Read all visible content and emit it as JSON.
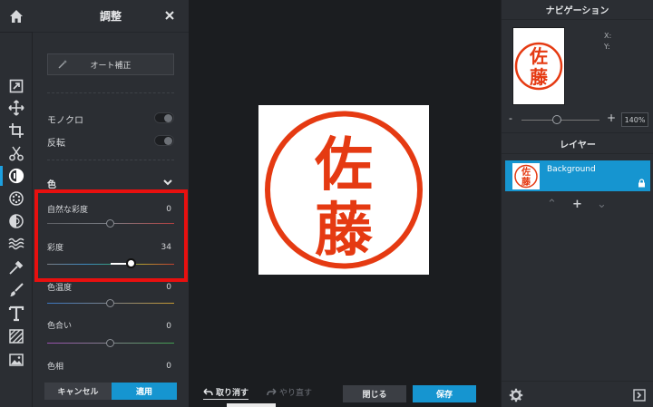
{
  "panel": {
    "title": "調整",
    "auto_fix_label": "オート補正",
    "toggles": [
      {
        "label": "モノクロ",
        "on": false
      },
      {
        "label": "反転",
        "on": false
      }
    ],
    "section_label": "色",
    "sliders": [
      {
        "label": "自然な彩度",
        "value": "0"
      },
      {
        "label": "彩度",
        "value": "34"
      },
      {
        "label": "色温度",
        "value": "0"
      },
      {
        "label": "色合い",
        "value": "0"
      },
      {
        "label": "色相",
        "value": "0"
      }
    ],
    "cancel_label": "キャンセル",
    "apply_label": "適用"
  },
  "canvas": {
    "seal_text": "佐藤",
    "undo_label": "取り消す",
    "redo_label": "やり直す",
    "close_label": "閉じる",
    "save_label": "保存"
  },
  "navigator": {
    "title": "ナビゲーション",
    "x_label": "X:",
    "y_label": "Y:",
    "zoom_minus": "-",
    "zoom_plus": "+",
    "zoom_value": "140%"
  },
  "layers": {
    "title": "レイヤー",
    "items": [
      {
        "name": "Background",
        "locked": true
      }
    ],
    "ctrl_up": "⌃",
    "ctrl_add": "+",
    "ctrl_down": "⌄"
  },
  "colors": {
    "accent": "#1695d0",
    "highlight": "#e8100f",
    "seal_red": "#e53a12"
  }
}
